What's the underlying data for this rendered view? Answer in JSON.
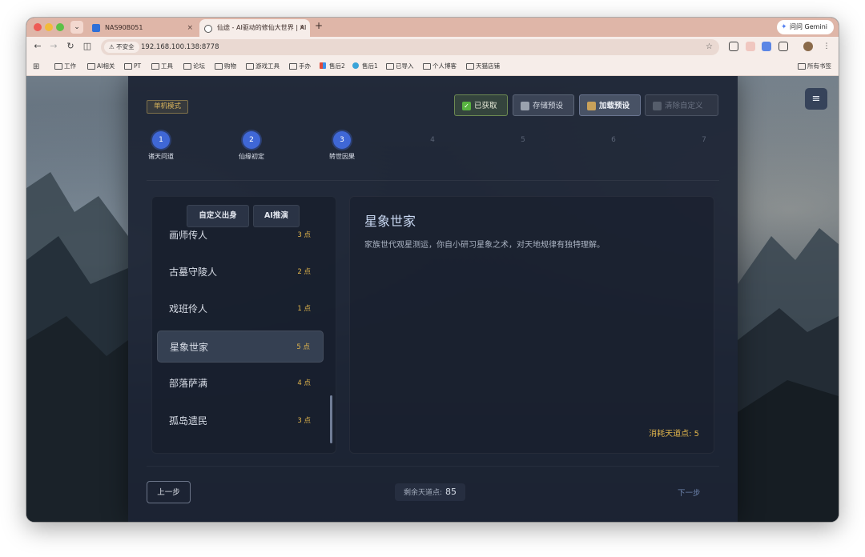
{
  "browser": {
    "tabs": [
      {
        "title": "NAS90B051",
        "close": "×"
      },
      {
        "title": "仙途 - AI驱动的修仙大世界 | AI",
        "close": "×"
      }
    ],
    "tab_list_glyph": "⌄",
    "new_tab": "+",
    "gemini_label": "问问 Gemini",
    "nav": {
      "back": "←",
      "forward": "→",
      "reload": "↻",
      "sidepanel": "◫"
    },
    "security_label": "不安全",
    "url": "192.168.100.138:8778",
    "bookmark_star": "☆",
    "bookmarks": [
      "工作",
      "AI相关",
      "PT",
      "工具",
      "论坛",
      "购物",
      "游戏工具",
      "手办",
      "售后2",
      "售后1",
      "已导入",
      "个人博客",
      "天猫店铺"
    ],
    "all_bookmarks": "所有书签",
    "apps_glyph": "⊞",
    "menu_glyph": "⋮"
  },
  "app": {
    "mode_badge": "单机模式",
    "top_buttons": {
      "acquired": "已获取",
      "save_preset": "存储预设",
      "load_preset": "加载预设",
      "clear_custom": "清除自定义"
    },
    "menu_icon": "≡",
    "steps": [
      {
        "num": "1",
        "label": "诸天问道",
        "done": true
      },
      {
        "num": "2",
        "label": "仙缘初定",
        "done": true
      },
      {
        "num": "3",
        "label": "转世因果",
        "done": true
      },
      {
        "num": "4",
        "label": "",
        "done": false
      },
      {
        "num": "5",
        "label": "",
        "done": false
      },
      {
        "num": "6",
        "label": "",
        "done": false
      },
      {
        "num": "7",
        "label": "",
        "done": false
      }
    ],
    "origin_tabs": {
      "custom": "自定义出身",
      "ai": "AI推演"
    },
    "origins": [
      {
        "name": "画师传人",
        "cost": "3 点"
      },
      {
        "name": "古墓守陵人",
        "cost": "2 点"
      },
      {
        "name": "戏班伶人",
        "cost": "1 点"
      },
      {
        "name": "星象世家",
        "cost": "5 点",
        "selected": true
      },
      {
        "name": "部落萨满",
        "cost": "4 点"
      },
      {
        "name": "孤岛遗民",
        "cost": "3 点"
      }
    ],
    "detail": {
      "title": "星象世家",
      "description": "家族世代观星测运，你自小研习星象之术，对天地规律有独特理解。",
      "cost": "消耗天道点: 5"
    },
    "footer": {
      "prev": "上一步",
      "remaining_label": "剩余天道点:",
      "remaining_value": "85",
      "next": "下一步"
    }
  }
}
